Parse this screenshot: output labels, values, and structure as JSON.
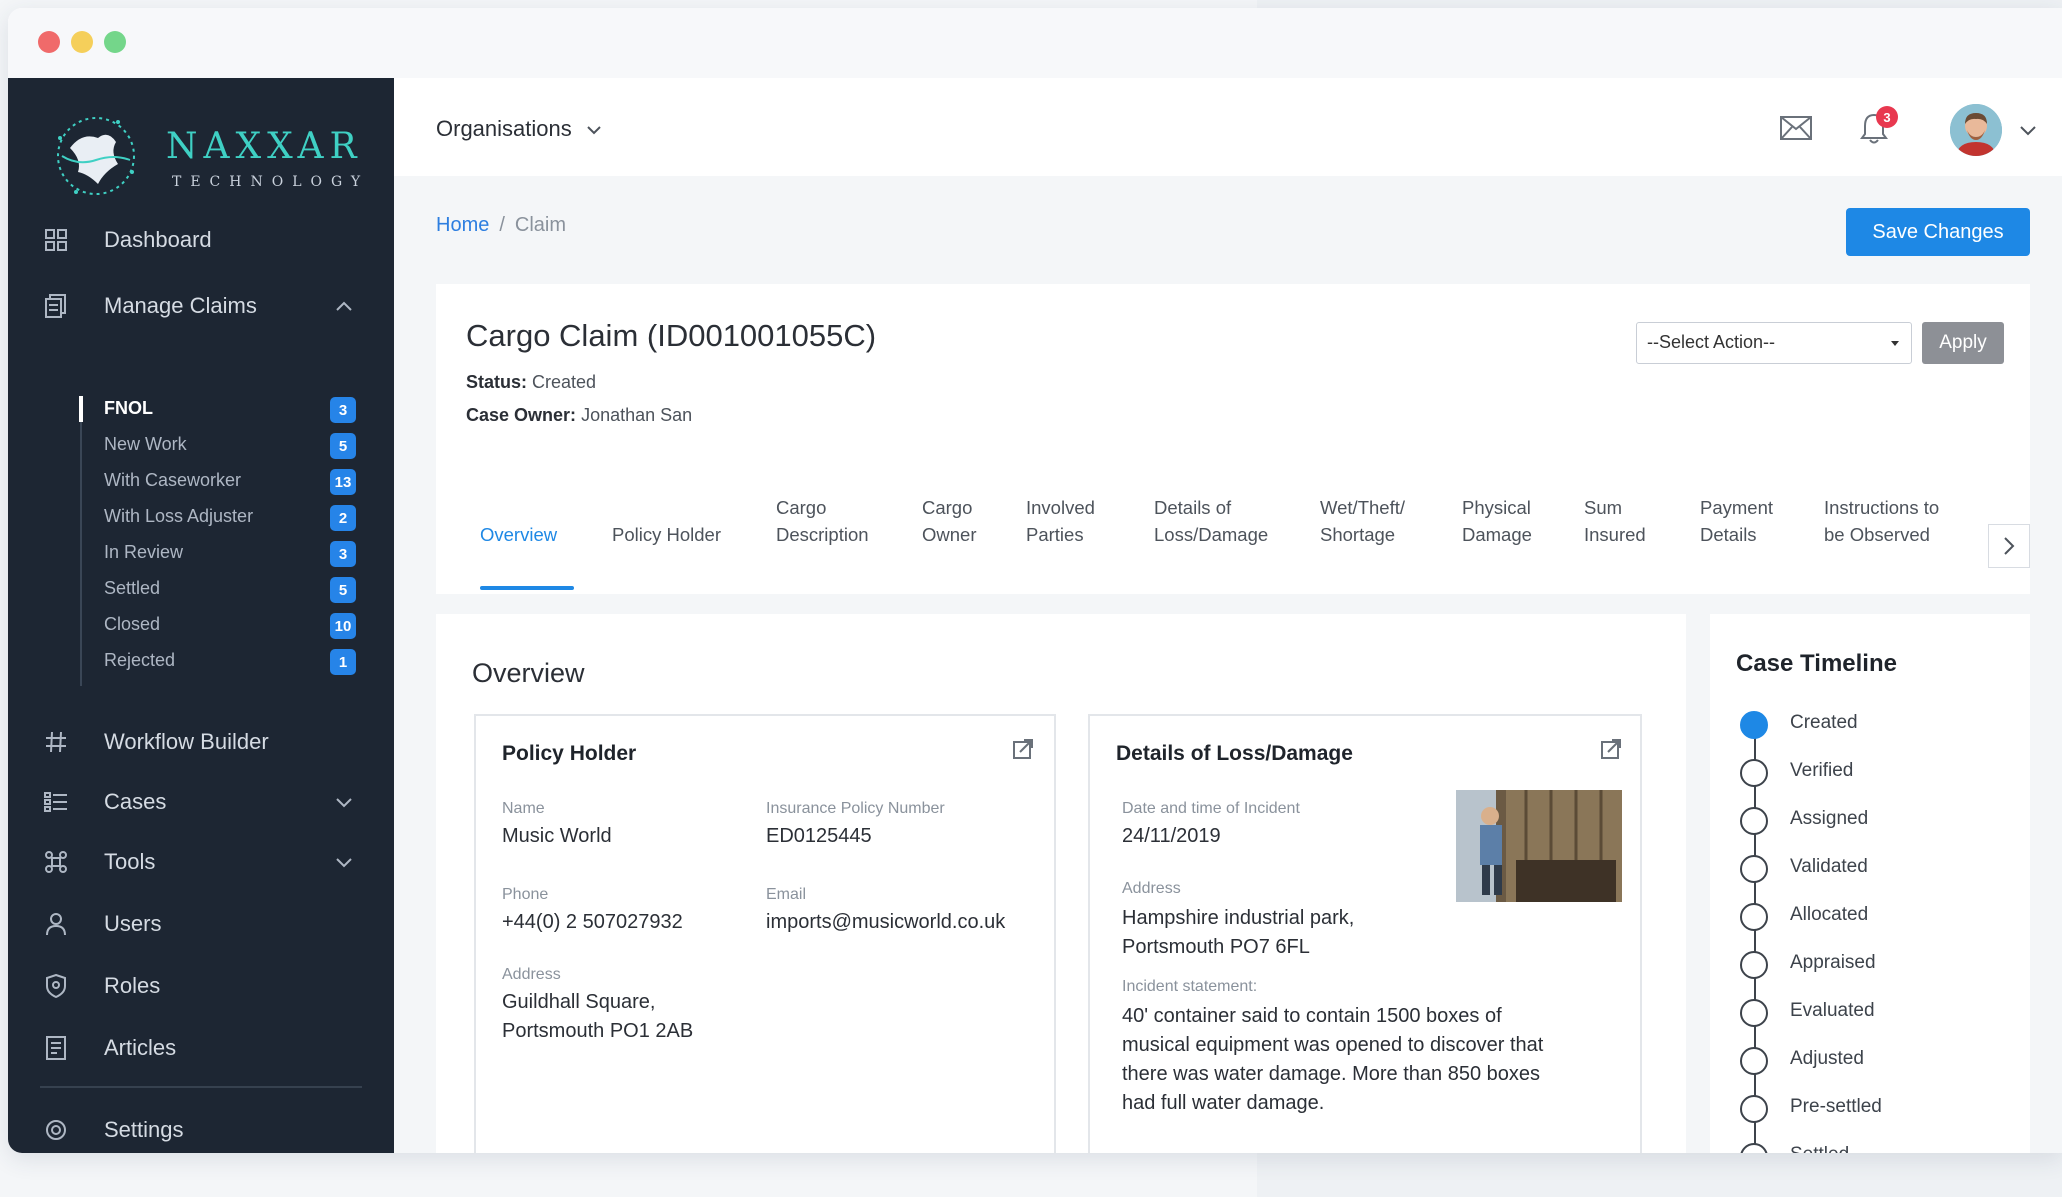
{
  "brand": {
    "name": "NAXXAR",
    "tagline": "TECHNOLOGY"
  },
  "sidebar": {
    "nav": [
      {
        "label": "Dashboard",
        "icon": "dashboard-icon"
      },
      {
        "label": "Manage Claims",
        "icon": "claims-icon",
        "expanded": true
      }
    ],
    "claims_subitems": [
      {
        "label": "FNOL",
        "count": "3",
        "active": true
      },
      {
        "label": "New Work",
        "count": "5"
      },
      {
        "label": "With Caseworker",
        "count": "13"
      },
      {
        "label": "With Loss Adjuster",
        "count": "2"
      },
      {
        "label": "In Review",
        "count": "3"
      },
      {
        "label": "Settled",
        "count": "5"
      },
      {
        "label": "Closed",
        "count": "10"
      },
      {
        "label": "Rejected",
        "count": "1"
      }
    ],
    "nav_lower": [
      {
        "label": "Workflow Builder",
        "icon": "hash-icon"
      },
      {
        "label": "Cases",
        "icon": "list-icon"
      },
      {
        "label": "Tools",
        "icon": "command-icon"
      },
      {
        "label": "Users",
        "icon": "user-icon"
      },
      {
        "label": "Roles",
        "icon": "shield-icon"
      },
      {
        "label": "Articles",
        "icon": "article-icon"
      },
      {
        "label": "Settings",
        "icon": "gear-icon"
      }
    ]
  },
  "topbar": {
    "org_label": "Organisations",
    "notification_count": "3"
  },
  "breadcrumb": {
    "home": "Home",
    "separator": "/",
    "current": "Claim"
  },
  "save_button": "Save Changes",
  "claim": {
    "title": "Cargo Claim (ID001001055C)",
    "status_label": "Status:",
    "status": "Created",
    "owner_label": "Case Owner:",
    "owner": "Jonathan San",
    "action_placeholder": "--Select Action--",
    "apply_label": "Apply"
  },
  "tabs": [
    "Overview",
    "Policy Holder",
    "Cargo\nDescription",
    "Cargo\nOwner",
    "Involved\nParties",
    "Details of\nLoss/Damage",
    "Wet/Theft/\nShortage",
    "Physical\nDamage",
    "Sum\nInsured",
    "Payment\nDetails",
    "Instructions to\nbe Observed"
  ],
  "overview": {
    "title": "Overview",
    "policy_holder": {
      "title": "Policy Holder",
      "name_label": "Name",
      "name": "Music World",
      "policy_label": "Insurance Policy Number",
      "policy": "ED0125445",
      "phone_label": "Phone",
      "phone": "+44(0) 2 507027932",
      "email_label": "Email",
      "email": "imports@musicworld.co.uk",
      "address_label": "Address",
      "address_line1": "Guildhall Square,",
      "address_line2": "Portsmouth PO1 2AB"
    },
    "loss": {
      "title": "Details of Loss/Damage",
      "date_label": "Date and time of  Incident",
      "date": "24/11/2019",
      "address_label": "Address",
      "address_line1": "Hampshire industrial park,",
      "address_line2": "Portsmouth PO7 6FL",
      "statement_label": "Incident statement:",
      "statement_lines": [
        "40' container said to contain 1500 boxes of",
        "musical equipment was opened to discover that",
        "there was water damage. More than 850 boxes",
        "had full water damage."
      ]
    }
  },
  "timeline": {
    "title": "Case Timeline",
    "steps": [
      {
        "label": "Created",
        "done": true
      },
      {
        "label": "Verified"
      },
      {
        "label": "Assigned"
      },
      {
        "label": "Validated"
      },
      {
        "label": "Allocated"
      },
      {
        "label": "Appraised"
      },
      {
        "label": "Evaluated"
      },
      {
        "label": "Adjusted"
      },
      {
        "label": "Pre-settled"
      },
      {
        "label": "Settled"
      }
    ]
  },
  "colors": {
    "sidebar_bg": "#1d2633",
    "accent": "#1e88e5",
    "badge": "#2684e8",
    "brand_teal": "#3fd0c4"
  }
}
